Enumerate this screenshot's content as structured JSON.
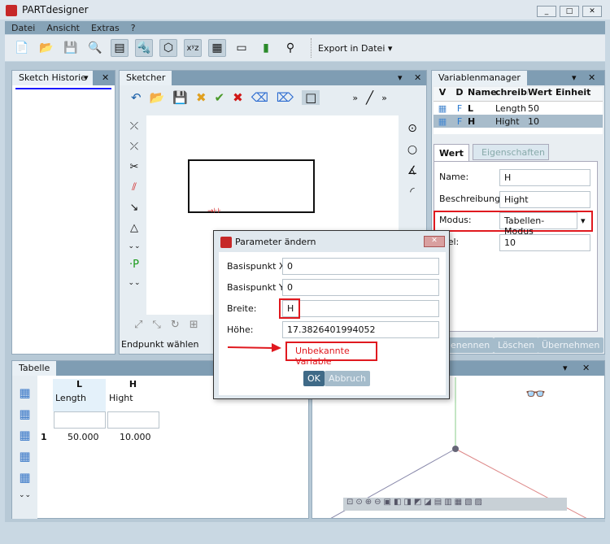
{
  "app": {
    "title": "PARTdesigner",
    "min": "_",
    "max": "□",
    "close": "✕"
  },
  "menu": [
    "Datei",
    "Ansicht",
    "Extras",
    "?"
  ],
  "toolbar": {
    "export_label": "Export in Datei",
    "icons": [
      "📄",
      "📂",
      "💾",
      "🔍",
      "▤",
      "🔩",
      "⬡",
      "xʸz",
      "▦",
      "▭",
      "▮",
      "⚲"
    ]
  },
  "sketch_historie": {
    "title": "Sketch Historie"
  },
  "sketcher": {
    "title": "Sketcher",
    "status": "Endpunkt wählen"
  },
  "varmanager": {
    "title": "Variablenmanager",
    "columns": [
      "V",
      "D",
      "Name",
      "chreibı",
      "Wert",
      "Einheit"
    ],
    "rows": [
      {
        "d": "F",
        "name": "L",
        "desc": "Length",
        "wert": "50",
        "einheit": ""
      },
      {
        "d": "F",
        "name": "H",
        "desc": "Hight",
        "wert": "10",
        "einheit": ""
      }
    ],
    "tabs": [
      "Wert",
      "Eigenschaften"
    ],
    "name_label": "Name:",
    "name_value": "H",
    "desc_label": "Beschreibung:",
    "desc_value": "Hight",
    "modus_label": "Modus:",
    "modus_value": "Tabellen-Modus",
    "formel_label": "mel:",
    "formel_value": "10",
    "buttons": [
      "enennen",
      "Löschen",
      "Übernehmen"
    ]
  },
  "tabelle": {
    "title": "Tabelle",
    "columns": [
      {
        "name": "L",
        "desc": "Length"
      },
      {
        "name": "H",
        "desc": "Hight"
      }
    ],
    "rows": [
      {
        "index": "1",
        "values": [
          "50.000",
          "10.000"
        ]
      }
    ]
  },
  "dialog": {
    "title": "Parameter ändern",
    "fields": [
      {
        "label": "Basispunkt X:",
        "value": "0"
      },
      {
        "label": "Basispunkt Y:",
        "value": "0"
      },
      {
        "label": "Breite:",
        "value": "H"
      },
      {
        "label": "Höhe:",
        "value": "17.3826401994052"
      }
    ],
    "error": "Unbekannte Variable",
    "ok": "OK",
    "cancel": "Abbruch"
  },
  "colors": {
    "accent": "#7f9db3",
    "error": "#e0191f",
    "ok_button": "#3f6a87"
  }
}
